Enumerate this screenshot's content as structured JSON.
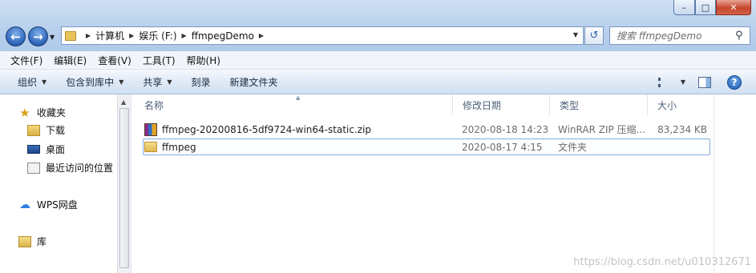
{
  "window": {
    "minimize_glyph": "–",
    "maximize_glyph": "□",
    "close_glyph": "✕"
  },
  "address_bar": {
    "breadcrumbs": [
      "计算机",
      "娱乐 (F:)",
      "ffmpegDemo"
    ],
    "search_placeholder": "搜索 ffmpegDemo"
  },
  "menu": [
    "文件(F)",
    "编辑(E)",
    "查看(V)",
    "工具(T)",
    "帮助(H)"
  ],
  "toolbar": {
    "organize": "组织",
    "include_in_library": "包含到库中",
    "share": "共享",
    "burn": "刻录",
    "new_folder": "新建文件夹"
  },
  "sidebar": {
    "favorites": "收藏夹",
    "downloads": "下载",
    "desktop": "桌面",
    "recent": "最近访问的位置",
    "wps": "WPS网盘",
    "libraries": "库"
  },
  "columns": {
    "name": "名称",
    "date": "修改日期",
    "type": "类型",
    "size": "大小"
  },
  "files": [
    {
      "name": "ffmpeg-20200816-5df9724-win64-static.zip",
      "date": "2020-08-18 14:23",
      "type": "WinRAR ZIP 压缩...",
      "size": "83,234 KB",
      "icon": "winrar-zip-icon"
    },
    {
      "name": "ffmpeg",
      "date": "2020-08-17 4:15",
      "type": "文件夹",
      "size": "",
      "icon": "folder-icon"
    }
  ],
  "watermark": "https://blog.csdn.net/u010312671",
  "colors": {
    "accent": "#2a63b8",
    "selection_border": "#84acdd"
  }
}
